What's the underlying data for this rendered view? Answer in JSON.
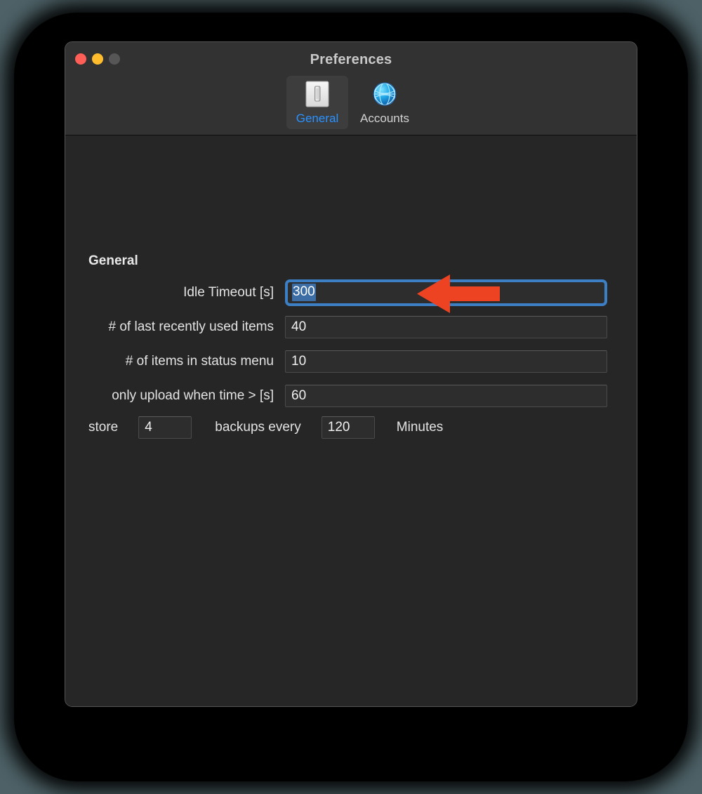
{
  "window": {
    "title": "Preferences",
    "traffic_lights": [
      {
        "name": "close",
        "color": "#ff5f56"
      },
      {
        "name": "minimize",
        "color": "#ffbd2e"
      },
      {
        "name": "zoom",
        "color": "#565656"
      }
    ]
  },
  "toolbar": {
    "items": [
      {
        "label": "General",
        "icon": "light-switch-icon",
        "selected": true
      },
      {
        "label": "Accounts",
        "icon": "globe-network-icon",
        "selected": false
      }
    ],
    "selected_color": "#2a91ff"
  },
  "main": {
    "section_title": "General",
    "rows": [
      {
        "label": "Idle Timeout [s]",
        "value": "300",
        "focused": true,
        "selected": true
      },
      {
        "label": "# of last recently used items",
        "value": "40",
        "focused": false,
        "selected": false
      },
      {
        "label": "# of items in status menu",
        "value": "10",
        "focused": false,
        "selected": false
      },
      {
        "label": "only upload when time > [s]",
        "value": "60",
        "focused": false,
        "selected": false
      }
    ],
    "backup_row": {
      "prefix_label": "store",
      "count_value": "4",
      "middle_label": "backups every",
      "interval_value": "120",
      "suffix_label": "Minutes"
    }
  },
  "annotation": {
    "type": "arrow",
    "direction": "left",
    "color": "#ee4323",
    "points_at": "Idle Timeout [s]"
  },
  "colors": {
    "desktop_background": "#4d6166",
    "window_background": "#262626",
    "titlebar_background": "#323232",
    "focus_ring": "#3c7fc4",
    "selection_background": "#3c6ea5"
  }
}
